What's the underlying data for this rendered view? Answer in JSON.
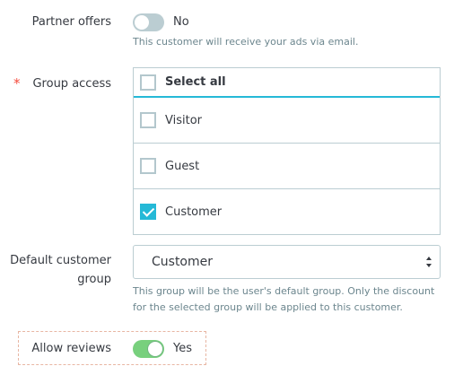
{
  "partner_offers": {
    "label": "Partner offers",
    "state_text": "No",
    "enabled": false,
    "help": "This customer will receive your ads via email."
  },
  "group_access": {
    "required_mark": "*",
    "label": "Group access",
    "select_all_label": "Select all",
    "select_all_checked": false,
    "options": [
      {
        "label": "Visitor",
        "checked": false
      },
      {
        "label": "Guest",
        "checked": false
      },
      {
        "label": "Customer",
        "checked": true
      }
    ]
  },
  "default_group": {
    "label_line1": "Default customer",
    "label_line2": "group",
    "selected": "Customer",
    "help_line1": "This group will be the user's default group. Only the discount",
    "help_line2": "for the selected group will be applied to this customer."
  },
  "allow_reviews": {
    "label": "Allow reviews",
    "state_text": "Yes",
    "enabled": true
  },
  "colors": {
    "accent": "#25b9d7",
    "toggle_on": "#78d07d",
    "toggle_off": "#bbcdd2",
    "required": "#f54c3e"
  }
}
